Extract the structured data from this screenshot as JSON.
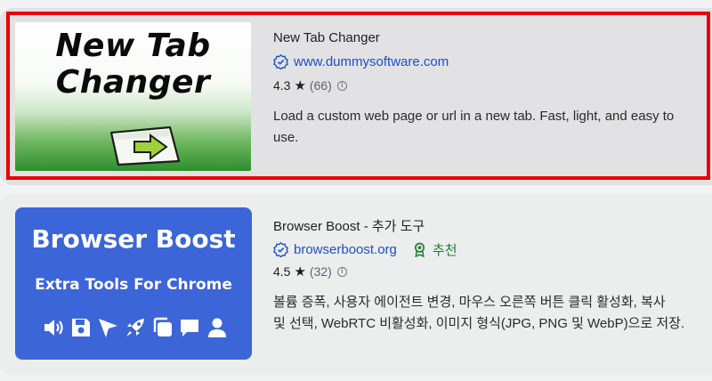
{
  "items": [
    {
      "thumb_line1": "New Tab",
      "thumb_line2": "Changer",
      "title": "New Tab Changer",
      "site": "www.dummysoftware.com",
      "rating": "4.3",
      "count": "(66)",
      "description_line1": "Load a custom web page or url in a new tab. Fast, light, and easy to",
      "description_line2": "use."
    },
    {
      "thumb_line1": "Browser Boost",
      "thumb_line2": "Extra Tools For Chrome",
      "title": "Browser Boost - 추가 도구",
      "site": "browserboost.org",
      "badge": "추천",
      "rating": "4.5",
      "count": "(32)",
      "description_line1": "볼륨 증폭, 사용자 에이전트 변경, 마우스 오른쪽 버튼 클릭 활성화, 복사",
      "description_line2": "및 선택, WebRTC 비활성화, 이미지 형식(JPG, PNG 및 WebP)으로 저장."
    }
  ],
  "icons": {
    "verified": "verified-icon",
    "recommended": "award-ribbon-icon",
    "star": "★",
    "info": "i"
  },
  "colors": {
    "selection_border": "#ea0000",
    "link": "#1a4fc8",
    "badge": "#1e7e34",
    "boost_blue": "#3c65d8"
  }
}
